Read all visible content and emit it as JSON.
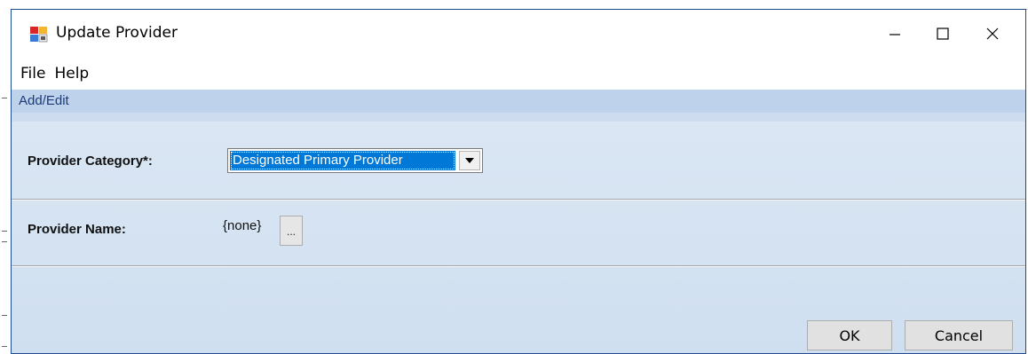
{
  "window": {
    "title": "Update Provider"
  },
  "menu": {
    "items": [
      "File",
      "Help"
    ]
  },
  "panel": {
    "header": "Add/Edit"
  },
  "form": {
    "category_label": "Provider Category*:",
    "category_value": "Designated Primary Provider",
    "name_label": "Provider Name:",
    "name_value": "{none}",
    "browse_label": "..."
  },
  "buttons": {
    "ok": "OK",
    "cancel": "Cancel"
  },
  "colors": {
    "selection": "#0078d7",
    "panel_header": "#bed2ec",
    "panel_bg": "#dce7f4",
    "window_border": "#1e4b8f"
  }
}
